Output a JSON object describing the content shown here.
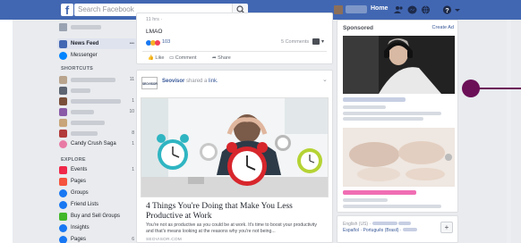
{
  "topbar": {
    "logo": "f",
    "search_placeholder": "Search Facebook",
    "home_label": "Home"
  },
  "leftnav": {
    "active_item": "News Feed",
    "main_items": [
      {
        "label": "News Feed",
        "count": "•••"
      },
      {
        "label": "Messenger",
        "count": ""
      }
    ],
    "shortcuts_header": "SHORTCUTS",
    "shortcuts": [
      {
        "count": "11"
      },
      {
        "count": ""
      },
      {
        "count": "1"
      },
      {
        "count": "10"
      },
      {
        "count": ""
      },
      {
        "count": "8"
      },
      {
        "label": "Candy Crush Saga",
        "count": "1"
      }
    ],
    "explore_header": "EXPLORE",
    "explore": [
      {
        "label": "Events",
        "count": "1"
      },
      {
        "label": "Pages",
        "count": ""
      },
      {
        "label": "Groups",
        "count": ""
      },
      {
        "label": "Friend Lists",
        "count": ""
      },
      {
        "label": "Buy and Sell Groups",
        "count": ""
      },
      {
        "label": "Insights",
        "count": ""
      },
      {
        "label": "Pages",
        "count": "6"
      }
    ],
    "colors": {
      "newsfeed": "#4267b2",
      "messenger": "#0084ff",
      "events": "#f02849",
      "pages": "#f5533d",
      "groups": "#1877f2",
      "friendlists": "#1877f2",
      "buysell": "#42b72a",
      "insights": "#1877f2",
      "pages2": "#1877f2",
      "candy": "#e87ba6"
    }
  },
  "feed": {
    "post1": {
      "time": "11 hrs · ",
      "text": "LMAO",
      "reactions_count": "103",
      "comments": "5 Comments",
      "like": "Like",
      "comment": "Comment",
      "share": "Share"
    },
    "post2": {
      "page_name": "Seovisor",
      "action": " shared a ",
      "link_word": "link.",
      "logo_text": "SEOVISOR",
      "headline": "4 Things You're Doing that Make You Less Productive at Work",
      "description": "You're not as productive as you could be at work. It's time to boost your productivity and that's means looking at the reasons why you're not being...",
      "domain": "SEOVISOR.COM"
    }
  },
  "rightcol": {
    "sponsored": "Sponsored",
    "create_ad": "Create Ad",
    "footer_langs": "English (US) · ",
    "footer_langs2": "Español · Português (Brasil) · ",
    "plus": "+"
  },
  "icons": {
    "search": "search-icon",
    "friends": "friends-icon",
    "messages": "messenger-icon",
    "notifications": "globe-icon",
    "help": "help-icon",
    "menu": "caret-down-icon"
  }
}
